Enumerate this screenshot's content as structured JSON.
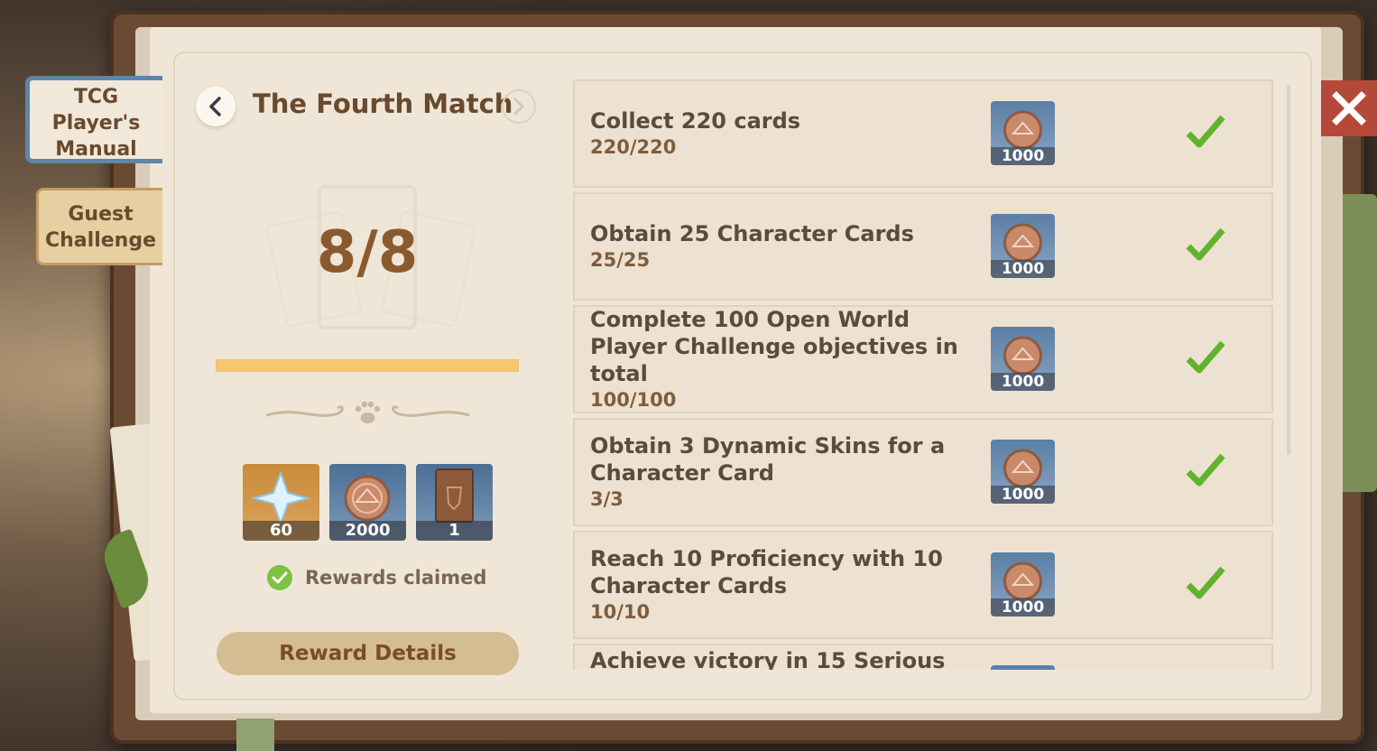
{
  "side_tabs": [
    {
      "label_lines": [
        "TCG",
        "Player's",
        "Manual"
      ],
      "active": true
    },
    {
      "label_lines": [
        "Guest",
        "Challenge"
      ],
      "active": false
    }
  ],
  "header": {
    "title": "The Fourth Match"
  },
  "progress": {
    "count": "8/8",
    "fraction": 1.0
  },
  "rewards": [
    {
      "icon": "primogem-icon",
      "count": "60"
    },
    {
      "icon": "coin-icon",
      "count": "2000"
    },
    {
      "icon": "card-back-icon",
      "count": "1"
    }
  ],
  "status": {
    "claimed_text": "Rewards claimed"
  },
  "reward_details_label": "Reward Details",
  "tasks": [
    {
      "title": "Collect 220 cards",
      "progress": "220/220",
      "reward": "1000",
      "completed": true
    },
    {
      "title": "Obtain 25 Character Cards",
      "progress": "25/25",
      "reward": "1000",
      "completed": true
    },
    {
      "title": "Complete 100 Open World Player Challenge objectives in total",
      "progress": "100/100",
      "reward": "1000",
      "completed": true
    },
    {
      "title": "Obtain 3 Dynamic Skins for a Character Card",
      "progress": "3/3",
      "reward": "1000",
      "completed": true
    },
    {
      "title": "Reach 10 Proficiency with 10 Character Cards",
      "progress": "10/10",
      "reward": "1000",
      "completed": true
    },
    {
      "title": "Achieve victory in 15 Serious",
      "progress": "",
      "reward": "",
      "completed": true
    }
  ],
  "colors": {
    "accent_blue": "#5d86a8",
    "check_green": "#7cc243",
    "progress_fill": "#f8c66b",
    "close_red": "#b4493a"
  }
}
